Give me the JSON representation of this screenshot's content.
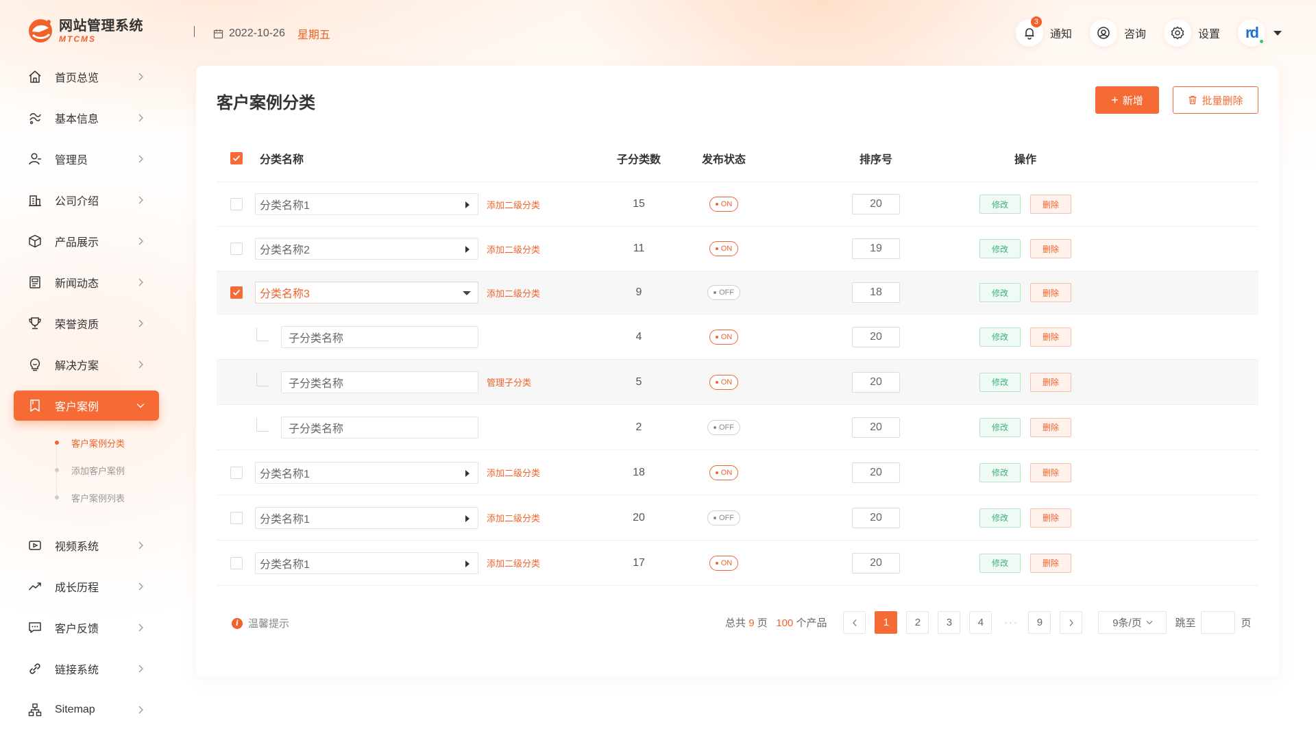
{
  "header": {
    "logo_title": "网站管理系统",
    "logo_sub": "MTCMS",
    "date": "2022-10-26",
    "weekday": "星期五",
    "notify_label": "通知",
    "notify_count": "3",
    "consult_label": "咨询",
    "settings_label": "设置",
    "avatar_text": "rd"
  },
  "sidebar": {
    "items": [
      {
        "label": "首页总览",
        "icon": "home-icon"
      },
      {
        "label": "基本信息",
        "icon": "info-icon"
      },
      {
        "label": "管理员",
        "icon": "user-icon"
      },
      {
        "label": "公司介绍",
        "icon": "building-icon"
      },
      {
        "label": "产品展示",
        "icon": "box-icon"
      },
      {
        "label": "新闻动态",
        "icon": "news-icon"
      },
      {
        "label": "荣誉资质",
        "icon": "trophy-icon"
      },
      {
        "label": "解决方案",
        "icon": "bulb-icon"
      },
      {
        "label": "客户案例",
        "icon": "bookmark-icon"
      },
      {
        "label": "视频系统",
        "icon": "video-icon"
      },
      {
        "label": "成长历程",
        "icon": "trend-icon"
      },
      {
        "label": "客户反馈",
        "icon": "chat-icon"
      },
      {
        "label": "链接系统",
        "icon": "link-icon"
      },
      {
        "label": "Sitemap",
        "icon": "sitemap-icon"
      }
    ],
    "active_index": 8,
    "submenu": [
      {
        "label": "客户案例分类",
        "active": true
      },
      {
        "label": "添加客户案例",
        "active": false
      },
      {
        "label": "客户案例列表",
        "active": false
      }
    ]
  },
  "main": {
    "title": "客户案例分类",
    "add_label": "新增",
    "bulk_delete_label": "批量删除",
    "columns": {
      "name": "分类名称",
      "children": "子分类数",
      "status": "发布状态",
      "sort": "排序号",
      "ops": "操作"
    },
    "edit_label": "修改",
    "delete_label": "删除",
    "rows": [
      {
        "type": "parent",
        "name": "分类名称1",
        "link": "添加二级分类",
        "children": "15",
        "status": "ON",
        "sort": "20",
        "checked": false,
        "expanded": false,
        "highlight": false
      },
      {
        "type": "parent",
        "name": "分类名称2",
        "link": "添加二级分类",
        "children": "11",
        "status": "ON",
        "sort": "19",
        "checked": false,
        "expanded": false,
        "highlight": false
      },
      {
        "type": "parent",
        "name": "分类名称3",
        "link": "添加二级分类",
        "children": "9",
        "status": "OFF",
        "sort": "18",
        "checked": true,
        "expanded": true,
        "highlight": true
      },
      {
        "type": "child",
        "name": "子分类名称",
        "link": "",
        "children": "4",
        "status": "ON",
        "sort": "20",
        "highlight": false
      },
      {
        "type": "child",
        "name": "子分类名称",
        "link": "管理子分类",
        "children": "5",
        "status": "ON",
        "sort": "20",
        "highlight": true
      },
      {
        "type": "child",
        "name": "子分类名称",
        "link": "",
        "children": "2",
        "status": "OFF",
        "sort": "20",
        "highlight": false
      },
      {
        "type": "parent",
        "name": "分类名称1",
        "link": "添加二级分类",
        "children": "18",
        "status": "ON",
        "sort": "20",
        "checked": false,
        "expanded": false,
        "highlight": false
      },
      {
        "type": "parent",
        "name": "分类名称1",
        "link": "添加二级分类",
        "children": "20",
        "status": "OFF",
        "sort": "20",
        "checked": false,
        "expanded": false,
        "highlight": false
      },
      {
        "type": "parent",
        "name": "分类名称1",
        "link": "添加二级分类",
        "children": "17",
        "status": "ON",
        "sort": "20",
        "checked": false,
        "expanded": false,
        "highlight": false
      }
    ]
  },
  "footer": {
    "tip_label": "温馨提示",
    "total_prefix": "总共",
    "total_pages": "9",
    "pages_unit": "页",
    "total_items": "100",
    "items_unit": "个产品",
    "pages": [
      "1",
      "2",
      "3",
      "4"
    ],
    "dots": "···",
    "last_page": "9",
    "current_page": "1",
    "page_size": "9条/页",
    "jump_label": "跳至",
    "jump_unit": "页"
  },
  "colors": {
    "accent": "#f66b35",
    "green": "#3bb37b"
  }
}
